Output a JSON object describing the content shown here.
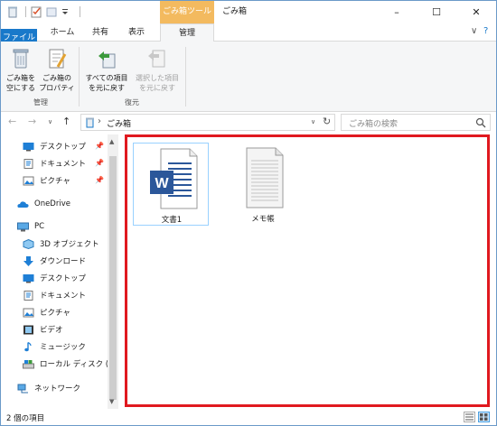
{
  "title_bar": {
    "context_tab": "ごみ箱ツール",
    "window_title": "ごみ箱",
    "minimize": "–",
    "maximize": "☐",
    "close": "✕"
  },
  "ribbon_tabs": {
    "file": "ファイル",
    "home": "ホーム",
    "share": "共有",
    "view": "表示",
    "manage": "管理",
    "collapse": "∨",
    "help": "?"
  },
  "ribbon": {
    "empty_line1": "ごみ箱を",
    "empty_line2": "空にする",
    "props_line1": "ごみ箱の",
    "props_line2": "プロパティ",
    "group_manage": "管理",
    "restore_all_line1": "すべての項目",
    "restore_all_line2": "を元に戻す",
    "restore_sel_line1": "選択した項目",
    "restore_sel_line2": "を元に戻す",
    "group_restore": "復元"
  },
  "address": {
    "back": "←",
    "forward": "→",
    "recent": "∨",
    "up": "↑",
    "separator": "›",
    "path": "ごみ箱",
    "dropdown": "∨",
    "refresh": "↻",
    "search_placeholder": "ごみ箱の検索",
    "search_icon": "search-icon"
  },
  "nav": {
    "quick_access": [
      {
        "label": "デスクトップ",
        "pinned": "📌"
      },
      {
        "label": "ドキュメント",
        "pinned": "📌"
      },
      {
        "label": "ピクチャ",
        "pinned": "📌"
      }
    ],
    "onedrive": "OneDrive",
    "pc": "PC",
    "pc_items": [
      {
        "label": "3D オブジェクト"
      },
      {
        "label": "ダウンロード"
      },
      {
        "label": "デスクトップ"
      },
      {
        "label": "ドキュメント"
      },
      {
        "label": "ピクチャ"
      },
      {
        "label": "ビデオ"
      },
      {
        "label": "ミュージック"
      },
      {
        "label": "ローカル ディスク (C:"
      }
    ],
    "network": "ネットワーク"
  },
  "files": [
    {
      "name": "文書1",
      "icon": "word-document-icon"
    },
    {
      "name": "メモ帳",
      "icon": "text-document-icon"
    }
  ],
  "status": {
    "item_count": "2 個の項目"
  },
  "colors": {
    "file_tab": "#1979ca",
    "context_tab": "#f3ba5f",
    "highlight_border": "#e0191f",
    "word_blue": "#2b579a"
  }
}
